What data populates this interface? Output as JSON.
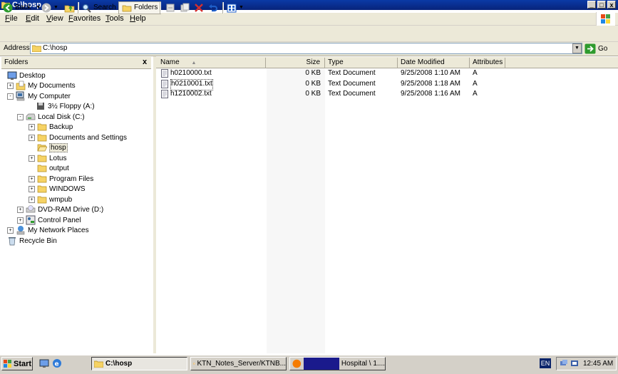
{
  "window": {
    "title": "C:\\hosp"
  },
  "title_buttons": {
    "minimize": "_",
    "maximize": "□",
    "close": "x"
  },
  "menu": [
    {
      "label": "File",
      "accel": "F",
      "rest": "ile"
    },
    {
      "label": "Edit",
      "accel": "E",
      "rest": "dit"
    },
    {
      "label": "View",
      "accel": "V",
      "rest": "iew"
    },
    {
      "label": "Favorites",
      "accel": "F",
      "rest": "avorites"
    },
    {
      "label": "Tools",
      "accel": "T",
      "rest": "ools"
    },
    {
      "label": "Help",
      "accel": "H",
      "rest": "elp"
    }
  ],
  "toolbar": {
    "back": "Back",
    "search": "Search",
    "folders": "Folders"
  },
  "address": {
    "label": "Address",
    "value": "C:\\hosp",
    "go": "Go"
  },
  "folders_pane": {
    "title": "Folders",
    "close": "x",
    "tree": [
      {
        "label": "Desktop",
        "icon": "desktop-icon",
        "exp": ""
      },
      {
        "label": "My Documents",
        "icon": "documents-icon",
        "exp": "+"
      },
      {
        "label": "My Computer",
        "icon": "computer-icon",
        "exp": "-"
      },
      {
        "label": "3½ Floppy (A:)",
        "icon": "floppy-icon",
        "exp": ""
      },
      {
        "label": "Local Disk (C:)",
        "icon": "drive-icon",
        "exp": "-"
      },
      {
        "label": "Backup",
        "icon": "folder-icon",
        "exp": "+"
      },
      {
        "label": "Documents and Settings",
        "icon": "folder-icon",
        "exp": "+"
      },
      {
        "label": "hosp",
        "icon": "folder-open-icon",
        "exp": ""
      },
      {
        "label": "Lotus",
        "icon": "folder-icon",
        "exp": "+"
      },
      {
        "label": "output",
        "icon": "folder-icon",
        "exp": ""
      },
      {
        "label": "Program Files",
        "icon": "folder-icon",
        "exp": "+"
      },
      {
        "label": "WINDOWS",
        "icon": "folder-icon",
        "exp": "+"
      },
      {
        "label": "wmpub",
        "icon": "folder-icon",
        "exp": "+"
      },
      {
        "label": "DVD-RAM Drive (D:)",
        "icon": "dvd-icon",
        "exp": "+"
      },
      {
        "label": "Control Panel",
        "icon": "control-panel-icon",
        "exp": "+"
      },
      {
        "label": "My Network Places",
        "icon": "network-icon",
        "exp": "+"
      },
      {
        "label": "Recycle Bin",
        "icon": "recycle-bin-icon",
        "exp": ""
      }
    ]
  },
  "file_list": {
    "columns": [
      "Name",
      "Size",
      "Type",
      "Date Modified",
      "Attributes"
    ],
    "sort_indicator": "▲",
    "rows": [
      {
        "name": "h0210000.txt",
        "size": "0 KB",
        "type": "Text Document",
        "date": "9/25/2008 1:10 AM",
        "attr": "A"
      },
      {
        "name": "h0210001.txt",
        "size": "0 KB",
        "type": "Text Document",
        "date": "9/25/2008 1:18 AM",
        "attr": "A"
      },
      {
        "name": "h1210002.txt",
        "size": "0 KB",
        "type": "Text Document",
        "date": "9/25/2008 1:16 AM",
        "attr": "A"
      }
    ]
  },
  "taskbar": {
    "start": "Start",
    "tasks": [
      {
        "label": "C:\\hosp",
        "active": true
      },
      {
        "label": "KTN_Notes_Server/KTNB..."
      },
      {
        "label": "Hospital \\ 1...."
      }
    ],
    "lang": "EN",
    "clock": "12:45 AM"
  },
  "colors": {
    "title": "#0a246a",
    "chrome": "#ece9d8",
    "select": "#ece9d8"
  }
}
